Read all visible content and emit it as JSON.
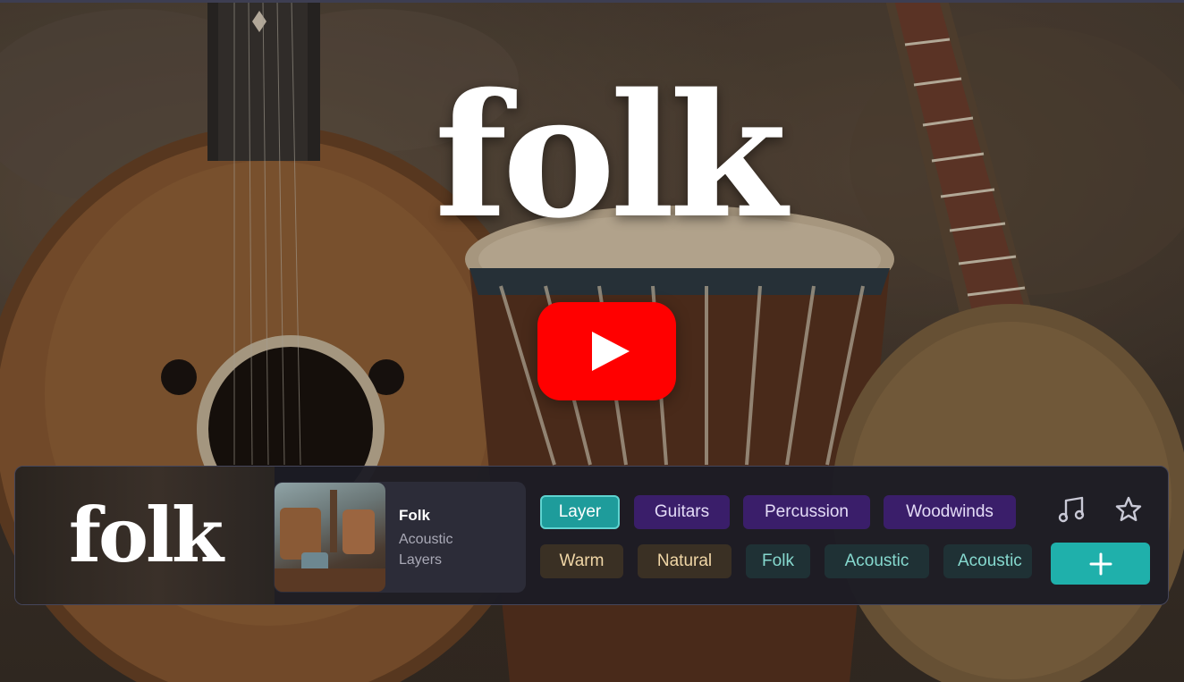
{
  "hero": {
    "title_art": "folk",
    "play_button_label": "Play video"
  },
  "player": {
    "logo_text": "folk",
    "product": {
      "title": "Folk",
      "subtitle_line1": "Acoustic",
      "subtitle_line2": "Layers"
    },
    "tags_row1": [
      "Layer",
      "Guitars",
      "Percussion",
      "Woodwinds"
    ],
    "tags_row2": [
      "Warm",
      "Natural",
      "Folk",
      "Acoustic",
      "Acoustic"
    ],
    "active_tag": "Layer",
    "icons": [
      "music-note-icon",
      "star-icon",
      "plus-icon"
    ]
  },
  "colors": {
    "play_red": "#ff0000",
    "accent_teal": "#1fb0ab",
    "tag_purple": "#3a1e6a",
    "tag_amber": "#3a3024",
    "tag_teal": "#1f3135",
    "bar_bg": "#1c1c24"
  }
}
